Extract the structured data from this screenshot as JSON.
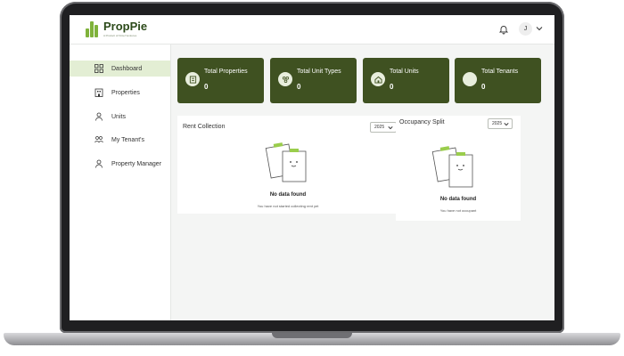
{
  "brand": {
    "name": "PropPie",
    "tagline": "A Product of Fintel Ventures"
  },
  "header": {
    "user_initial": "J"
  },
  "sidebar": {
    "items": [
      {
        "label": "Dashboard",
        "icon": "grid-icon",
        "active": true
      },
      {
        "label": "Properties",
        "icon": "building-icon",
        "active": false
      },
      {
        "label": "Units",
        "icon": "user-icon",
        "active": false
      },
      {
        "label": "My Tenant's",
        "icon": "users-icon",
        "active": false
      },
      {
        "label": "Property Manager",
        "icon": "user-icon",
        "active": false
      }
    ]
  },
  "stats": [
    {
      "title": "Total Properties",
      "value": "0",
      "icon": "building-icon"
    },
    {
      "title": "Total Unit Types",
      "value": "0",
      "icon": "units-icon"
    },
    {
      "title": "Total Units",
      "value": "0",
      "icon": "home-icon"
    },
    {
      "title": "Total Tenants",
      "value": "0",
      "icon": "circle-icon"
    }
  ],
  "rent_collection": {
    "title": "Rent Collection",
    "year": "2025",
    "empty_title": "No data found",
    "empty_subtitle": "You have not started collecting rent yet"
  },
  "occupancy_split": {
    "title": "Occupancy Split",
    "year": "2025",
    "empty_title": "No data found",
    "empty_subtitle": "You have not occupant"
  },
  "colors": {
    "accent": "#3f5121",
    "brand_green": "#7fb23b",
    "active_nav": "#e3eed4"
  }
}
